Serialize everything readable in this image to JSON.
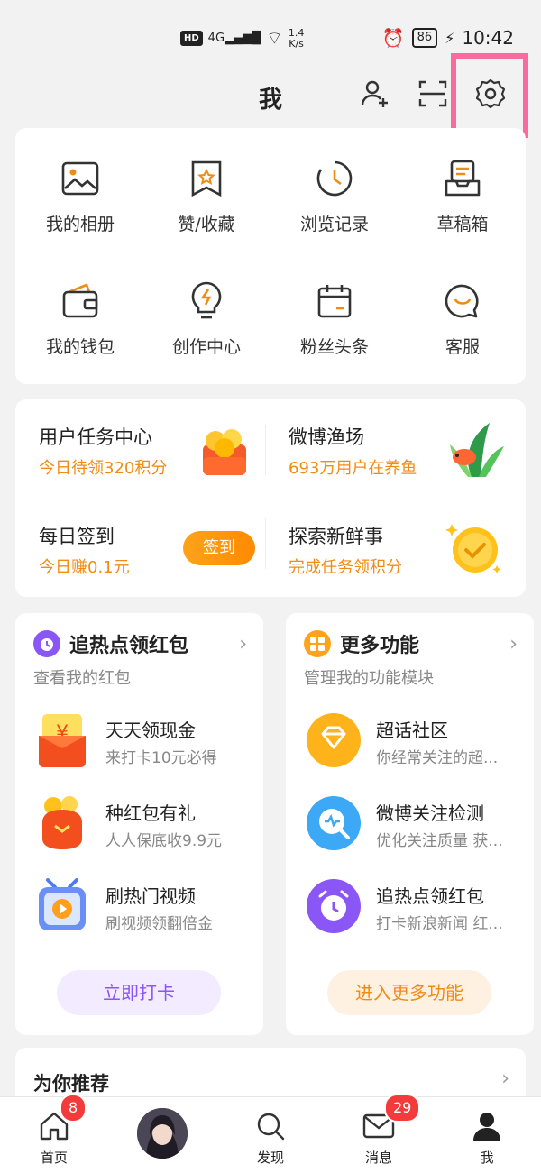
{
  "status": {
    "signal_tag": "4G",
    "hd": "HD",
    "speed_value": "1.4",
    "speed_unit": "K/s",
    "battery": "86",
    "time": "10:42"
  },
  "header": {
    "title": "我"
  },
  "grid": [
    {
      "label": "我的相册",
      "icon": "photo-album-icon"
    },
    {
      "label": "赞/收藏",
      "icon": "bookmark-star-icon"
    },
    {
      "label": "浏览记录",
      "icon": "history-clock-icon"
    },
    {
      "label": "草稿箱",
      "icon": "draft-box-icon"
    },
    {
      "label": "我的钱包",
      "icon": "wallet-icon"
    },
    {
      "label": "创作中心",
      "icon": "lightbulb-icon"
    },
    {
      "label": "粉丝头条",
      "icon": "calendar-icon"
    },
    {
      "label": "客服",
      "icon": "customer-service-icon"
    }
  ],
  "tasks": {
    "task_center": {
      "title": "用户任务中心",
      "sub": "今日待领320积分"
    },
    "fishing": {
      "title": "微博渔场",
      "sub": "693万用户在养鱼"
    },
    "checkin": {
      "title": "每日签到",
      "sub": "今日赚0.1元",
      "button": "签到"
    },
    "explore": {
      "title": "探索新鲜事",
      "sub": "完成任务领积分"
    }
  },
  "left_panel": {
    "title": "追热点领红包",
    "sub": "查看我的红包",
    "items": [
      {
        "title": "天天领现金",
        "sub": "来打卡10元必得"
      },
      {
        "title": "种红包有礼",
        "sub": "人人保底收9.9元"
      },
      {
        "title": "刷热门视频",
        "sub": "刷视频领翻倍金"
      }
    ],
    "button": "立即打卡"
  },
  "right_panel": {
    "title": "更多功能",
    "sub": "管理我的功能模块",
    "items": [
      {
        "title": "超话社区",
        "sub": "你经常关注的超..."
      },
      {
        "title": "微博关注检测",
        "sub": "优化关注质量 获..."
      },
      {
        "title": "追热点领红包",
        "sub": "打卡新浪新闻 红..."
      }
    ],
    "button": "进入更多功能"
  },
  "recommend": {
    "title": "为你推荐"
  },
  "tabs": [
    {
      "label": "首页",
      "badge": "8"
    },
    {
      "label": "",
      "badge": ""
    },
    {
      "label": "发现",
      "badge": ""
    },
    {
      "label": "消息",
      "badge": "29"
    },
    {
      "label": "我",
      "badge": ""
    }
  ],
  "colors": {
    "accent_orange": "#f08c14",
    "highlight_pink": "#f76b9f",
    "badge_red": "#f43b3b"
  }
}
